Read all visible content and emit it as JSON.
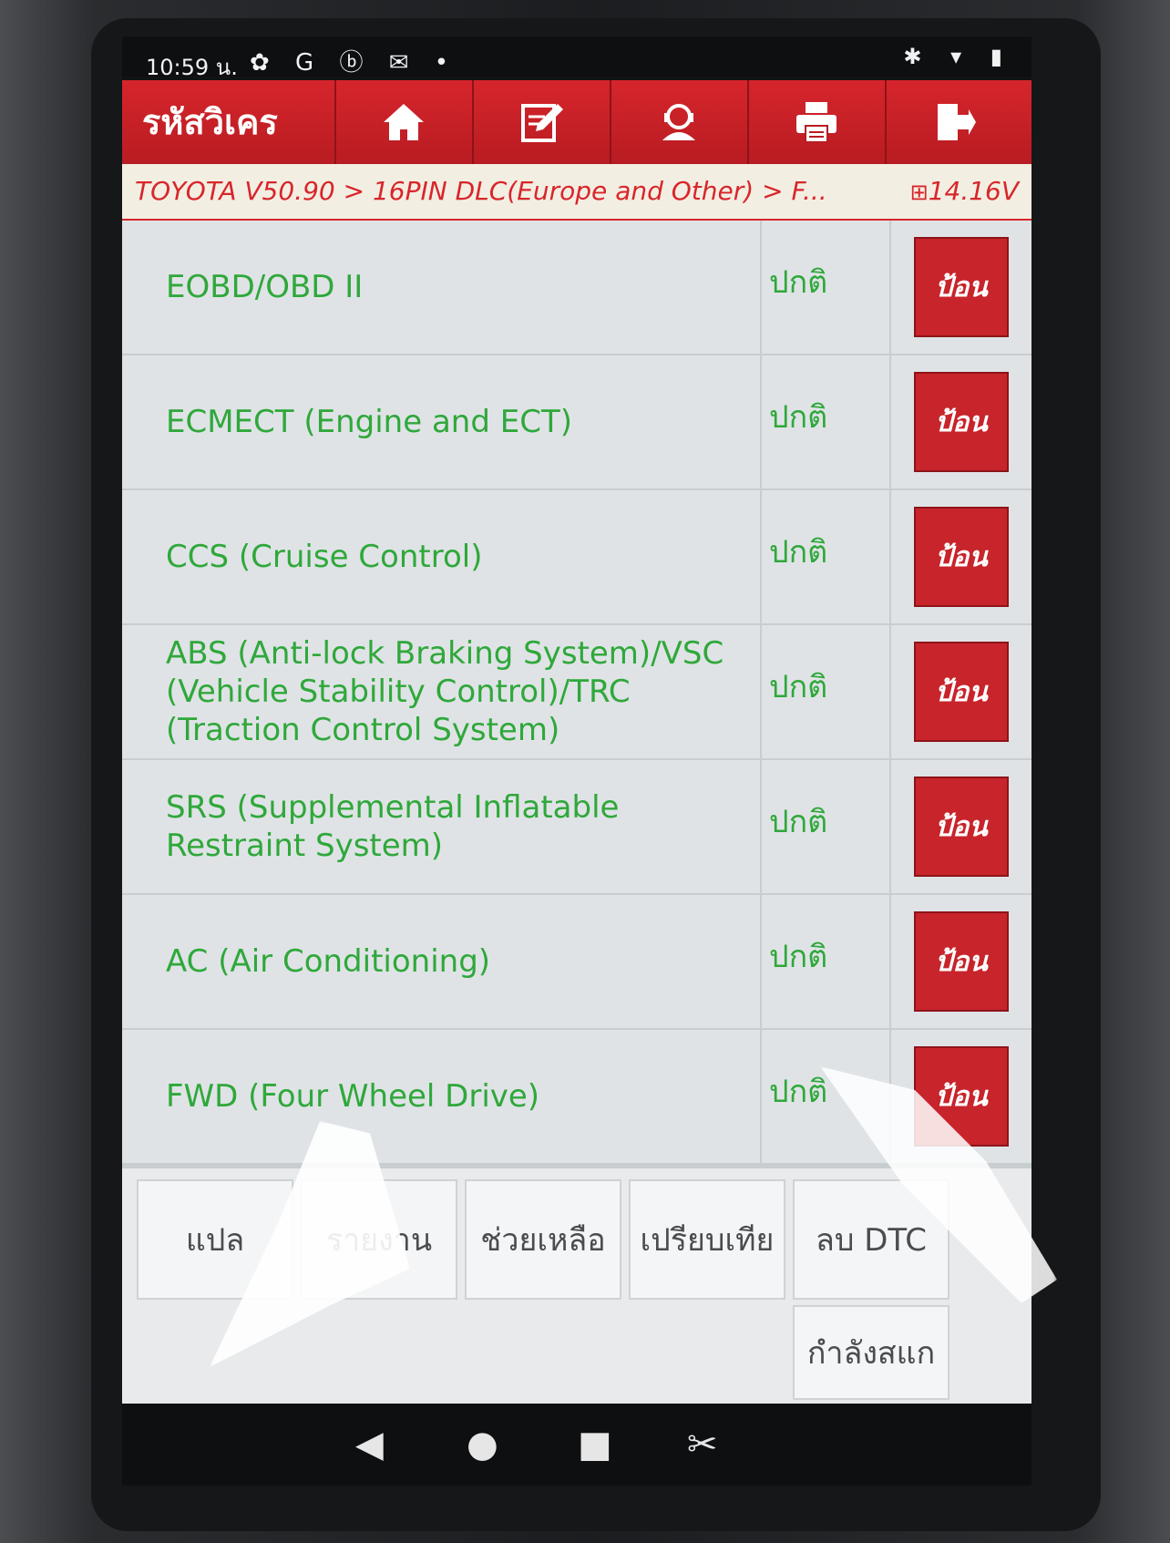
{
  "status_bar": {
    "time": "10:59 น.",
    "left_icons": "✿ G ⓑ ✉ •",
    "right_icons": "✱ ▾ ▮"
  },
  "toolbar": {
    "title": "รหัสวิเคร",
    "buttons": [
      "home-icon",
      "edit-icon",
      "support-icon",
      "print-icon",
      "exit-icon"
    ]
  },
  "breadcrumb": {
    "path": "TOYOTA V50.90 > 16PIN DLC(Europe and Other) > F...",
    "voltage": "14.16V"
  },
  "systems": [
    {
      "name": "EOBD/OBD II",
      "status": "ปกติ",
      "action": "ป้อน"
    },
    {
      "name": "ECMECT (Engine and ECT)",
      "status": "ปกติ",
      "action": "ป้อน"
    },
    {
      "name": "CCS (Cruise Control)",
      "status": "ปกติ",
      "action": "ป้อน"
    },
    {
      "name": "ABS (Anti-lock Braking System)/VSC (Vehicle Stability Control)/TRC (Traction Control System)",
      "status": "ปกติ",
      "action": "ป้อน"
    },
    {
      "name": "SRS (Supplemental Inflatable Restraint System)",
      "status": "ปกติ",
      "action": "ป้อน"
    },
    {
      "name": "AC (Air Conditioning)",
      "status": "ปกติ",
      "action": "ป้อน"
    },
    {
      "name": "FWD (Four Wheel Drive)",
      "status": "ปกติ",
      "action": "ป้อน"
    }
  ],
  "function_buttons": {
    "translate": "แปล",
    "report": "รายงาน",
    "help": "ช่วยเหลือ",
    "compare": "เปรียบเทีย",
    "clear_dtc": "ลบ DTC",
    "scanning": "กำลังสแก"
  },
  "colors": {
    "brand_red": "#c8242b",
    "system_text_green": "#2fa83a"
  }
}
